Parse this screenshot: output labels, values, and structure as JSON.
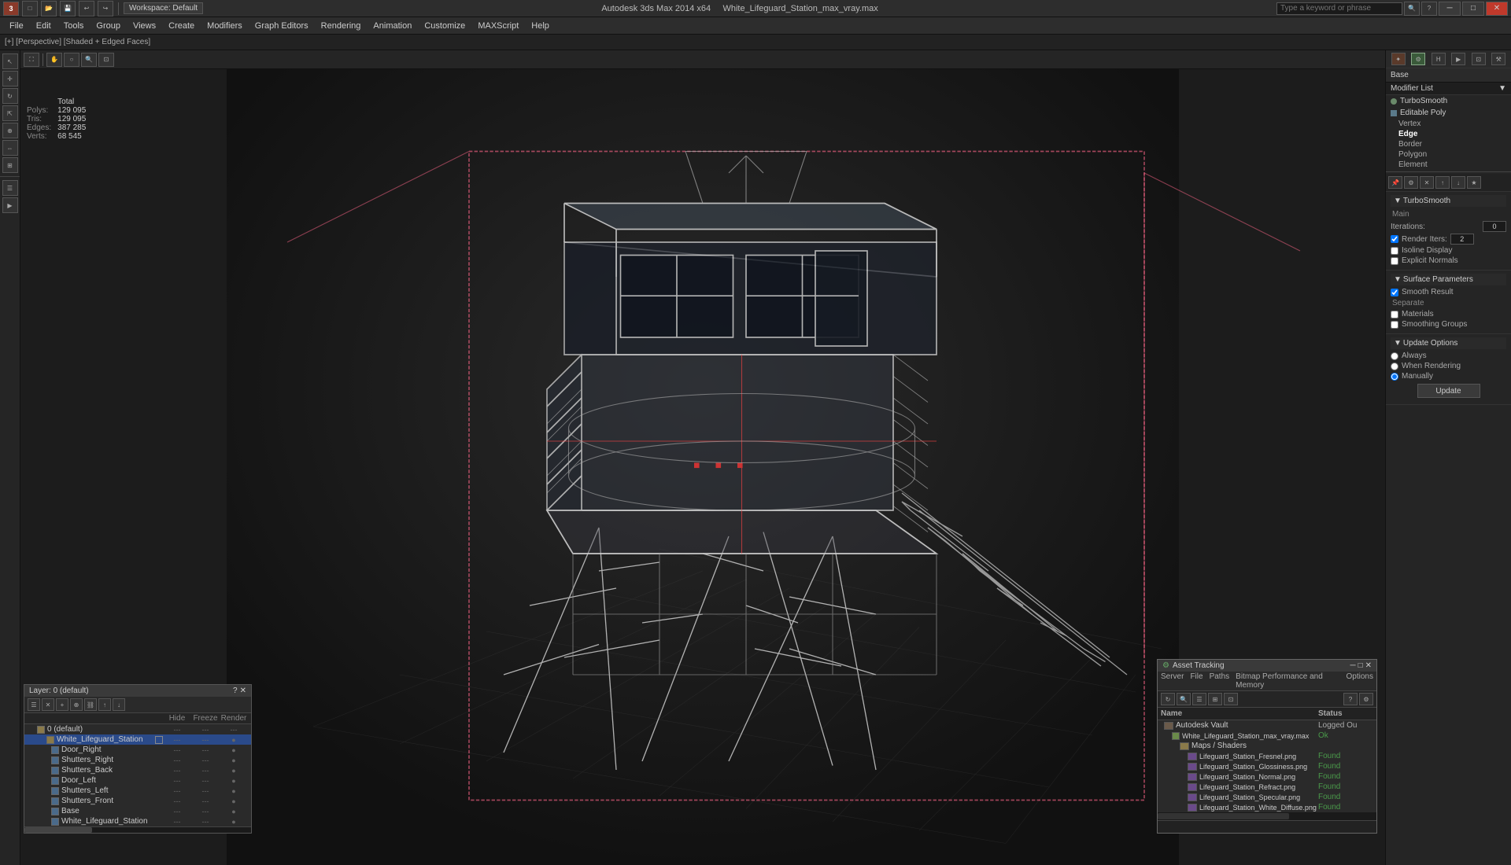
{
  "titlebar": {
    "app_icon": "3ds",
    "workspace": "Workspace: Default",
    "filename": "White_Lifeguard_Station_max_vray.max",
    "app_name": "Autodesk 3ds Max 2014 x64",
    "search_placeholder": "Type a keyword or phrase",
    "minimize": "─",
    "maximize": "□",
    "close": "✕"
  },
  "menubar": {
    "items": [
      "File",
      "Edit",
      "Tools",
      "Group",
      "Views",
      "Create",
      "Modifiers",
      "Graph Editors",
      "Rendering",
      "Animation",
      "Customize",
      "MAXScript",
      "Help"
    ]
  },
  "breadcrumb": "[+] [Perspective] [Shaded + Edged Faces]",
  "stats": {
    "label_polys": "Polys:",
    "label_tris": "Tris:",
    "label_edges": "Edges:",
    "label_verts": "Verts:",
    "header": "Total",
    "polys": "129 095",
    "tris": "129 095",
    "edges": "387 285",
    "verts": "68 545"
  },
  "modifier_panel": {
    "base_label": "Base",
    "modifier_list_label": "Modifier List",
    "dropdown_arrow": "▼",
    "items": [
      {
        "name": "TurboSmooth",
        "icon": "●",
        "level": 0
      },
      {
        "name": "Editable Poly",
        "icon": "■",
        "level": 0
      },
      {
        "name": "Vertex",
        "level": 1
      },
      {
        "name": "Edge",
        "level": 1,
        "active": true
      },
      {
        "name": "Border",
        "level": 1
      },
      {
        "name": "Polygon",
        "level": 1
      },
      {
        "name": "Element",
        "level": 1
      }
    ]
  },
  "turbosmooth": {
    "title": "TurboSmooth",
    "main_label": "Main",
    "iterations_label": "Iterations:",
    "iterations_val": "0",
    "render_iters_label": "Render Iters:",
    "render_iters_val": "2",
    "isoline_display": "Isoline Display",
    "explicit_normals": "Explicit Normals",
    "surface_params": "Surface Parameters",
    "smooth_result": "Smooth Result",
    "separate_label": "Separate",
    "materials_label": "Materials",
    "smoothing_groups": "Smoothing Groups",
    "update_options": "Update Options",
    "always": "Always",
    "when_rendering": "When Rendering",
    "manually": "Manually",
    "update_btn": "Update"
  },
  "layer_panel": {
    "title": "Layer: 0 (default)",
    "close": "✕",
    "minimize": "?",
    "columns": {
      "hide": "Hide",
      "freeze": "Freeze",
      "render": "Render"
    },
    "layers": [
      {
        "name": "0 (default)",
        "indent": 0,
        "type": "layer",
        "hide": "---",
        "freeze": "---",
        "render": "---"
      },
      {
        "name": "White_Lifeguard_Station",
        "indent": 1,
        "type": "layer",
        "selected": true,
        "hide": "---",
        "freeze": "---",
        "render": "●"
      },
      {
        "name": "Door_Right",
        "indent": 2,
        "type": "obj",
        "hide": "---",
        "freeze": "---",
        "render": "●"
      },
      {
        "name": "Shutters_Right",
        "indent": 2,
        "type": "obj",
        "hide": "---",
        "freeze": "---",
        "render": "●"
      },
      {
        "name": "Shutters_Back",
        "indent": 2,
        "type": "obj",
        "hide": "---",
        "freeze": "---",
        "render": "●"
      },
      {
        "name": "Door_Left",
        "indent": 2,
        "type": "obj",
        "hide": "---",
        "freeze": "---",
        "render": "●"
      },
      {
        "name": "Shutters_Left",
        "indent": 2,
        "type": "obj",
        "hide": "---",
        "freeze": "---",
        "render": "●"
      },
      {
        "name": "Shutters_Front",
        "indent": 2,
        "type": "obj",
        "hide": "---",
        "freeze": "---",
        "render": "●"
      },
      {
        "name": "Base",
        "indent": 2,
        "type": "obj",
        "hide": "---",
        "freeze": "---",
        "render": "●"
      },
      {
        "name": "White_Lifeguard_Station",
        "indent": 2,
        "type": "obj",
        "hide": "---",
        "freeze": "---",
        "render": "●"
      }
    ]
  },
  "asset_panel": {
    "title": "Asset Tracking",
    "close": "✕",
    "minimize": "─",
    "maximize": "□",
    "menus": [
      "Server",
      "File",
      "Paths",
      "Bitmap Performance and Memory",
      "Options"
    ],
    "col_name": "Name",
    "col_status": "Status",
    "assets": [
      {
        "name": "Autodesk Vault",
        "indent": 0,
        "type": "vault",
        "status": "Logged Ou"
      },
      {
        "name": "White_Lifeguard_Station_max_vray.max",
        "indent": 1,
        "type": "file",
        "status": "Ok"
      },
      {
        "name": "Maps / Shaders",
        "indent": 2,
        "type": "folder",
        "status": ""
      },
      {
        "name": "Lifeguard_Station_Fresnel.png",
        "indent": 3,
        "type": "img",
        "status": "Found"
      },
      {
        "name": "Lifeguard_Station_Glossiness.png",
        "indent": 3,
        "type": "img",
        "status": "Found"
      },
      {
        "name": "Lifeguard_Station_Normal.png",
        "indent": 3,
        "type": "img",
        "status": "Found"
      },
      {
        "name": "Lifeguard_Station_Refract.png",
        "indent": 3,
        "type": "img",
        "status": "Found"
      },
      {
        "name": "Lifeguard_Station_Specular.png",
        "indent": 3,
        "type": "img",
        "status": "Found"
      },
      {
        "name": "Lifeguard_Station_White_Diffuse.png",
        "indent": 3,
        "type": "img",
        "status": "Found"
      }
    ]
  }
}
